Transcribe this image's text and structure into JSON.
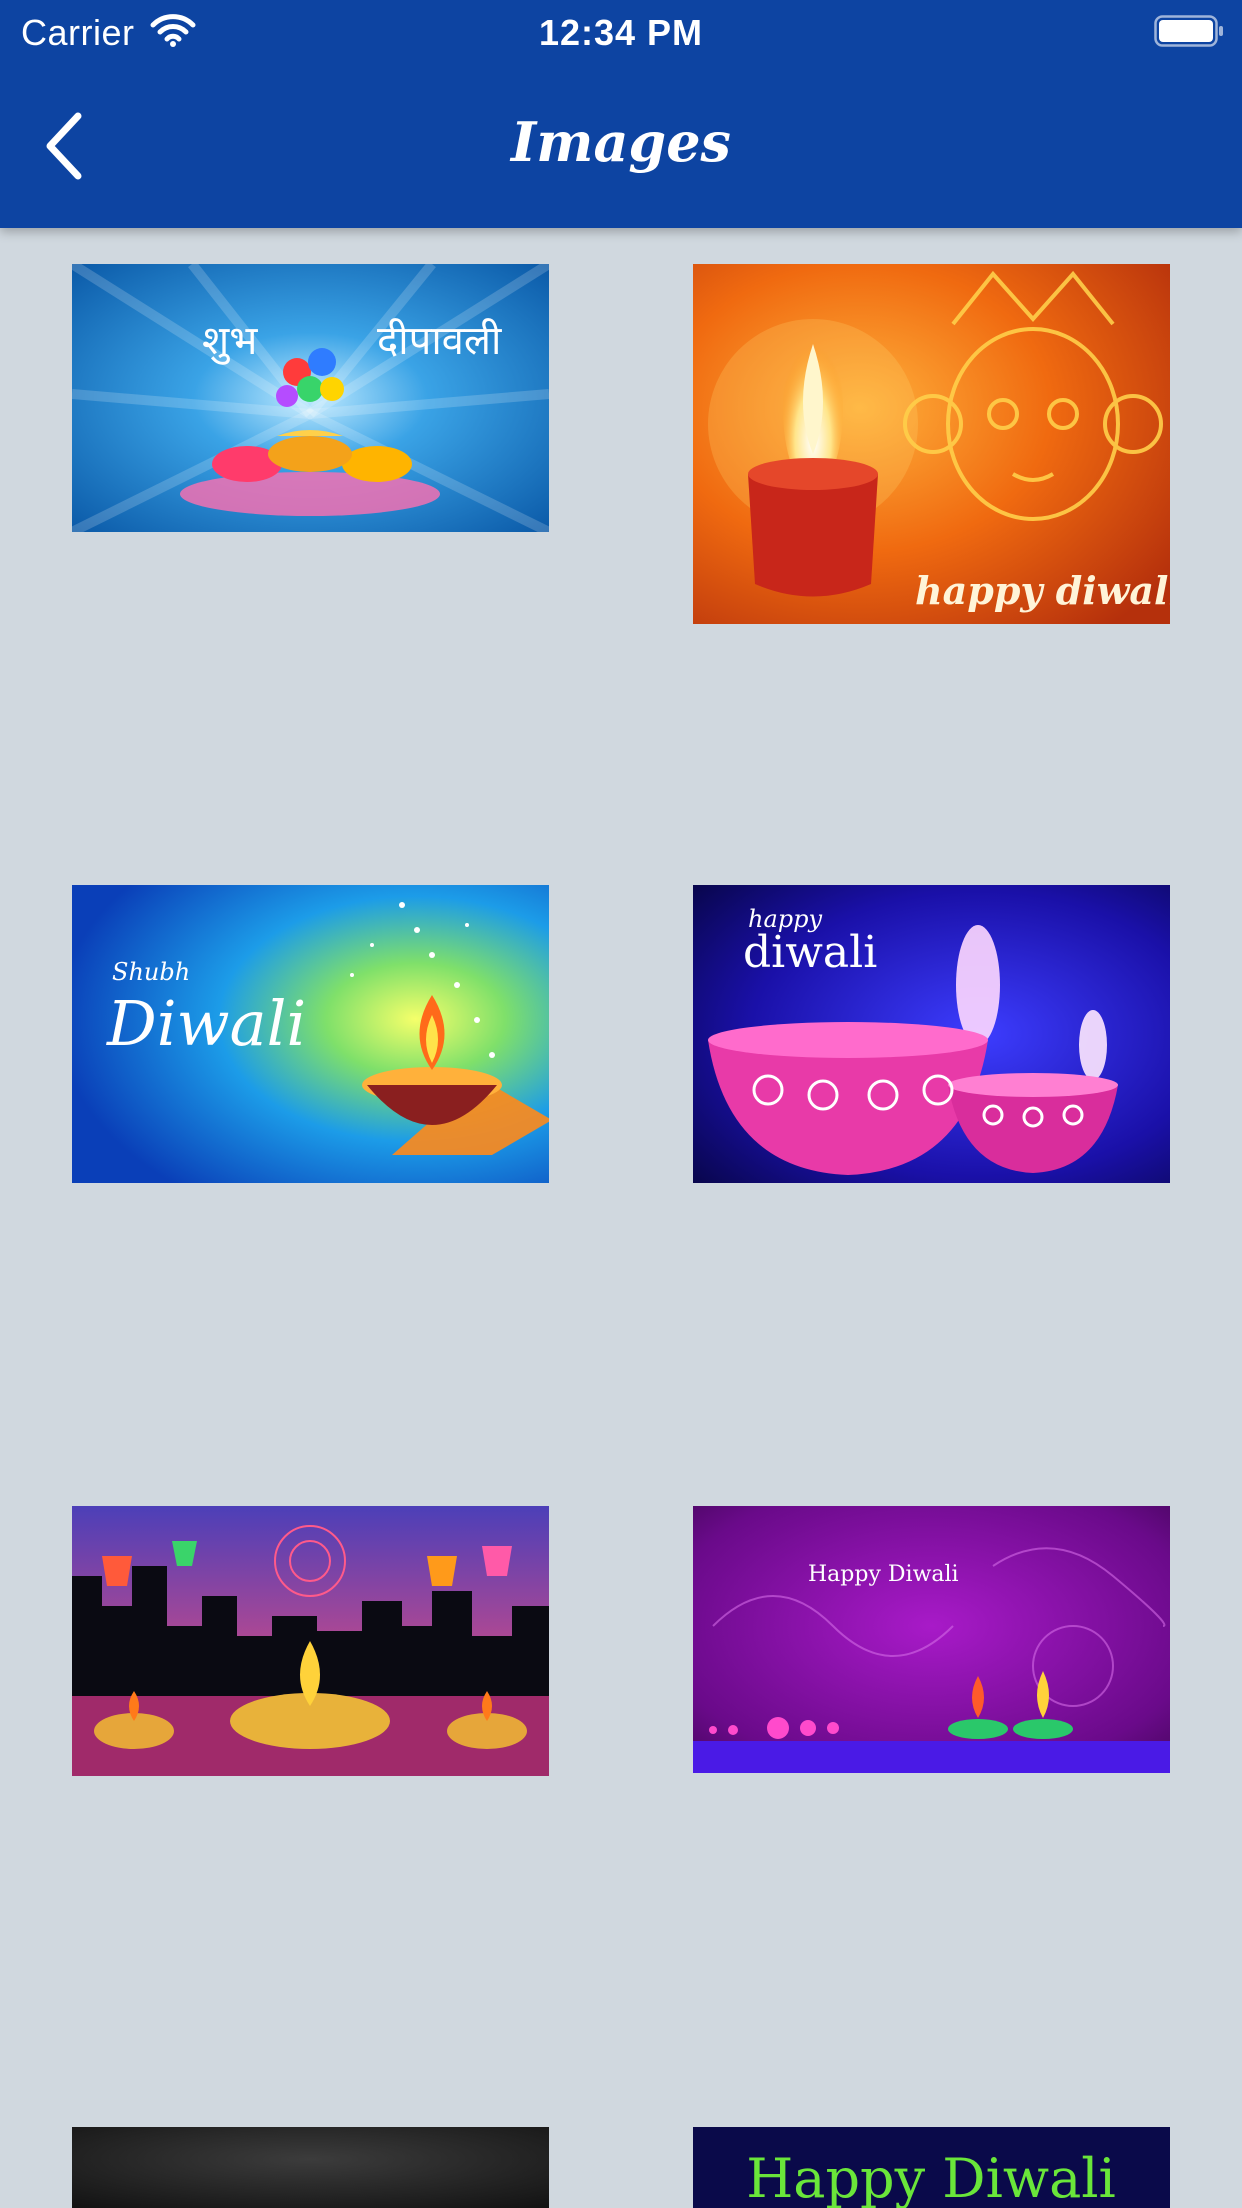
{
  "status_bar": {
    "carrier": "Carrier",
    "time": "12:34 PM"
  },
  "nav": {
    "title": "Images",
    "back_icon": "chevron-left-icon"
  },
  "colors": {
    "nav_background": "#0d44a2",
    "page_background": "#d0d8df"
  },
  "gallery": {
    "images": [
      {
        "name": "shubh-deepawali-blue-rays",
        "text_devanagari_1": "शुभ",
        "text_devanagari_2": "दीपावली"
      },
      {
        "name": "happy-diwali-orange-durga",
        "caption": "happy diwali"
      },
      {
        "name": "shubh-diwali-blue-diya",
        "caption_small": "Shubh",
        "caption_large": "Diwali"
      },
      {
        "name": "happy-diwali-pink-bowls",
        "caption_top": "happy",
        "caption_large": "diwali"
      },
      {
        "name": "diwali-lanterns-skyline"
      },
      {
        "name": "happy-diwali-purple",
        "caption": "Happy Diwali"
      },
      {
        "name": "dark-gradient-card"
      },
      {
        "name": "happy-diwali-green-text",
        "caption": "Happy Diwali"
      }
    ]
  }
}
